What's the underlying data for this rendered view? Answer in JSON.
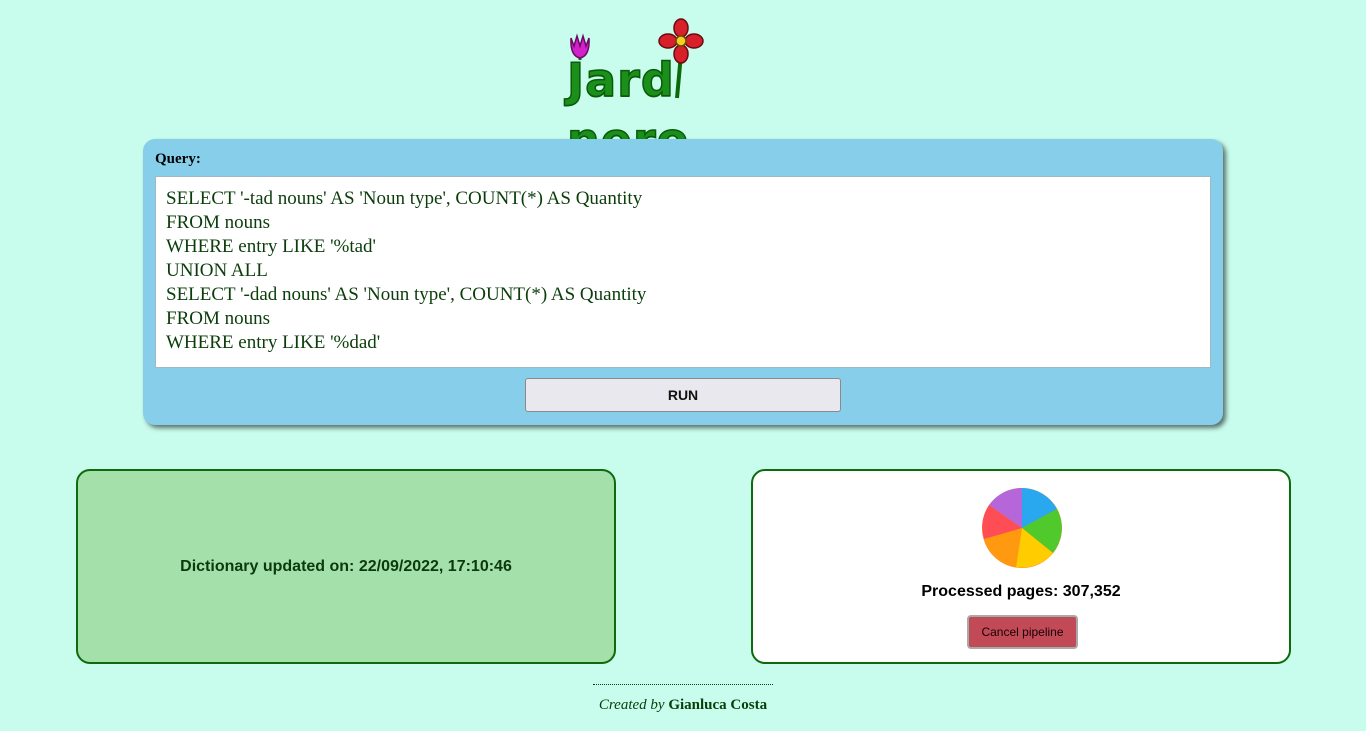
{
  "logo": {
    "text_part1": "Jard",
    "text_part2": "nero"
  },
  "query": {
    "label": "Query:",
    "value": "SELECT '-tad nouns' AS 'Noun type', COUNT(*) AS Quantity\nFROM nouns\nWHERE entry LIKE '%tad'\nUNION ALL\nSELECT '-dad nouns' AS 'Noun type', COUNT(*) AS Quantity\nFROM nouns\nWHERE entry LIKE '%dad'",
    "run_label": "RUN"
  },
  "status": {
    "dictionary_updated": "Dictionary updated on: 22/09/2022, 17:10:46",
    "processed_pages": "Processed pages: 307,352",
    "cancel_label": "Cancel pipeline"
  },
  "footer": {
    "created_by": "Created by",
    "author": "Gianluca Costa"
  },
  "colors": {
    "background": "#c8fcec",
    "panel": "#87ceea",
    "card_left": "#a4e0a9",
    "card_border": "#0d6a0d",
    "cancel": "#c24a57",
    "logo_green": "#1a8f1a"
  },
  "icons": {
    "logo_tulip": "tulip-icon",
    "logo_flower": "flower-icon",
    "spinner": "spinner-icon"
  }
}
